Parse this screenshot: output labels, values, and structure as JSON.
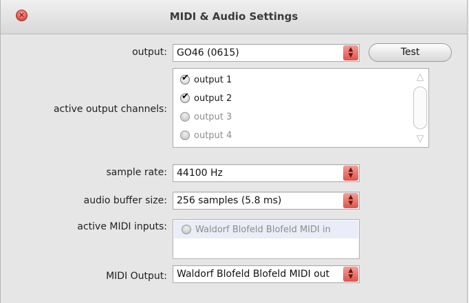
{
  "window": {
    "title": "MIDI & Audio Settings"
  },
  "output": {
    "label": "output:",
    "selected": "GO46 (0615)",
    "test_label": "Test"
  },
  "channels": {
    "label": "active output channels:",
    "items": [
      {
        "label": "output 1",
        "checked": true,
        "enabled": true
      },
      {
        "label": "output 2",
        "checked": true,
        "enabled": true
      },
      {
        "label": "output 3",
        "checked": false,
        "enabled": false
      },
      {
        "label": "output 4",
        "checked": false,
        "enabled": false
      }
    ]
  },
  "sample_rate": {
    "label": "sample rate:",
    "selected": "44100 Hz"
  },
  "buffer_size": {
    "label": "audio buffer size:",
    "selected": "256 samples (5.8 ms)"
  },
  "midi_inputs": {
    "label": "active MIDI inputs:",
    "items": [
      {
        "label": "Waldorf Blofeld Blofeld MIDI in",
        "checked": false,
        "enabled": false
      }
    ]
  },
  "midi_output": {
    "label": "MIDI Output:",
    "selected": "Waldorf Blofeld Blofeld MIDI out"
  },
  "icons": {
    "close": "close-icon",
    "dropdown": "updown-arrows-icon",
    "checkbox": "checkmark-icon",
    "scroll_up": "triangle-up-icon",
    "scroll_down": "triangle-down-icon"
  },
  "colors": {
    "accent": "#e0534b",
    "close_button": "#e5534b",
    "selection": "#eaedf7"
  }
}
